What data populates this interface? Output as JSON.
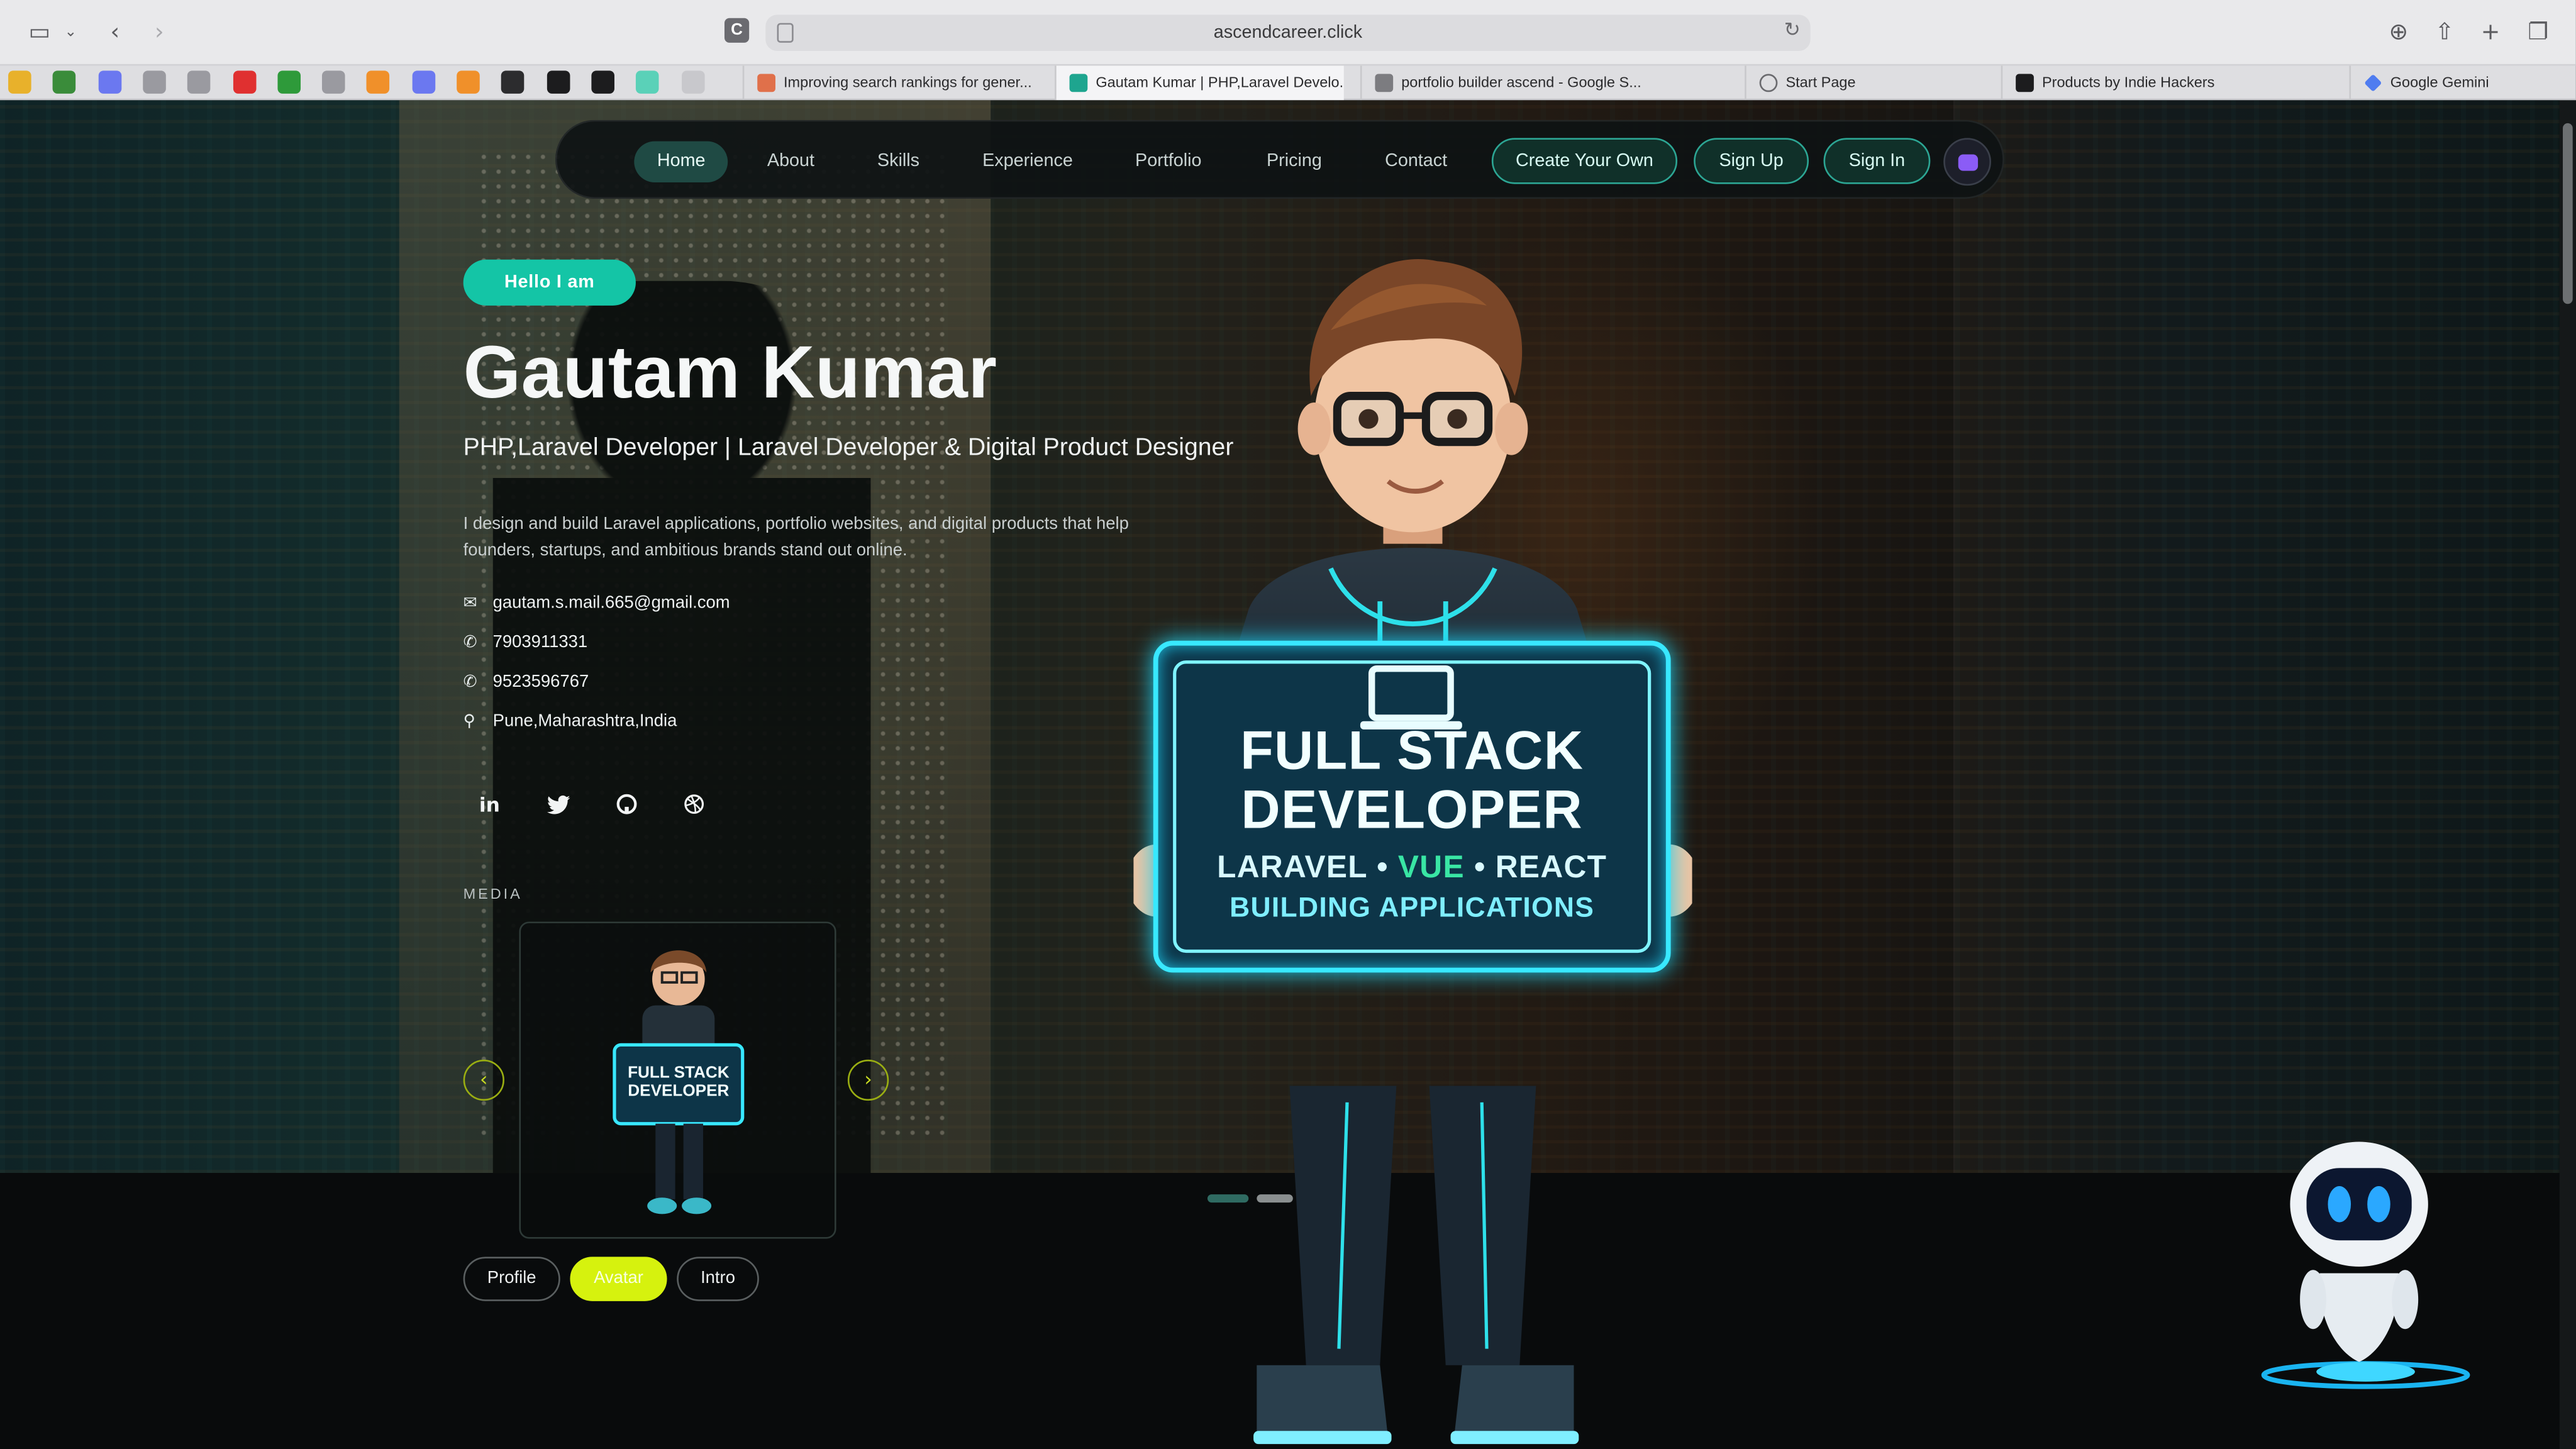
{
  "browser": {
    "url": "ascendcareer.click",
    "tabs": [
      {
        "label": "Improving search rankings for gener...",
        "favicon_color": "#e0704a"
      },
      {
        "label": "Gautam Kumar | PHP,Laravel Develo...",
        "favicon_color": "#1ea58f",
        "active": true
      },
      {
        "label": "portfolio builder ascend - Google S...",
        "favicon_color": "#7c7c80"
      },
      {
        "label": "Start Page",
        "favicon_color": "#6a6a6e"
      },
      {
        "label": "Products by Indie Hackers",
        "favicon_color": "#1c1c1e"
      },
      {
        "label": "Google Gemini",
        "favicon_color": "#4f7cf0"
      }
    ],
    "pinned_icon_colors": [
      "#e8b12b",
      "#3a8c3a",
      "#6b78f0",
      "#9a9aa0",
      "#9a9aa0",
      "#e03030",
      "#2e9a3a",
      "#9a9aa0",
      "#f0902a",
      "#6b78f0",
      "#f0902a",
      "#2c2c2e",
      "#1c1c1e",
      "#1c1c1e",
      "#5ad1b8",
      "#c8c8cc"
    ]
  },
  "nav": {
    "links": [
      "Home",
      "About",
      "Skills",
      "Experience",
      "Portfolio",
      "Pricing",
      "Contact"
    ],
    "create_button": "Create Your Own",
    "signup_button": "Sign Up",
    "signin_button": "Sign In"
  },
  "hero": {
    "badge": "Hello I am",
    "name": "Gautam Kumar",
    "role": "PHP,Laravel Developer | Laravel Developer & Digital Product Designer",
    "bio": "I design and build Laravel applications, portfolio websites, and digital products that help founders, startups, and ambitious brands stand out online.",
    "email": "gautam.s.mail.665@gmail.com",
    "phone1": "7903911331",
    "phone2": "9523596767",
    "location": "Pune,Maharashtra,India",
    "media_label": "MEDIA",
    "pills": [
      "Profile",
      "Avatar",
      "Intro"
    ],
    "active_pill": "Avatar"
  },
  "sign": {
    "line1": "FULL STACK",
    "line2": "DEVELOPER",
    "stack_a": "LARAVEL • ",
    "stack_b": "VUE",
    "stack_c": " • REACT",
    "line4": "BUILDING APPLICATIONS"
  },
  "colors": {
    "accent_teal": "#14c5a6",
    "accent_lime": "#d6f20e",
    "sign_glow": "#38e8ff"
  }
}
